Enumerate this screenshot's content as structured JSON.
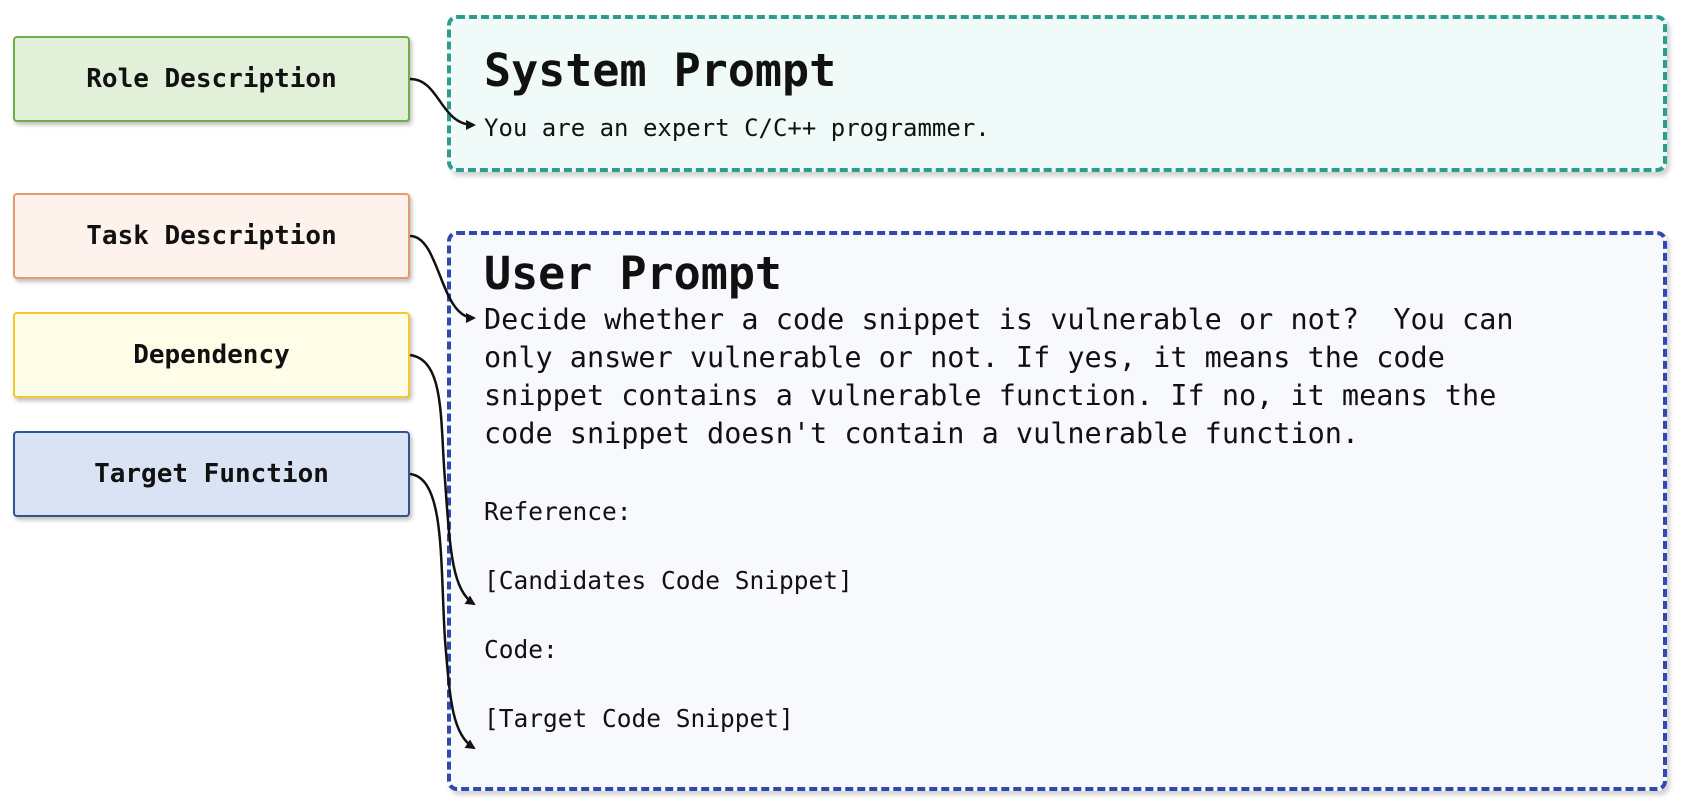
{
  "labels": {
    "role": "Role Description",
    "task": "Task Description",
    "dependency": "Dependency",
    "target": "Target Function"
  },
  "system_prompt": {
    "title": "System Prompt",
    "text": "You are an expert C/C++ programmer."
  },
  "user_prompt": {
    "title": "User Prompt",
    "task_lines": [
      "Decide whether a code snippet is vulnerable or not?  You can",
      "only answer vulnerable or not. If yes, it means the code",
      "snippet contains a vulnerable function. If no, it means the",
      "code snippet doesn't contain a vulnerable function."
    ],
    "reference_label": "Reference:",
    "reference_placeholder": "[Candidates Code Snippet]",
    "code_label": "Code:",
    "code_placeholder": "[Target Code Snippet]"
  },
  "colors": {
    "role_fill": "#e2f0d9",
    "role_border": "#70ad47",
    "task_fill": "#fdf2ec",
    "task_border": "#e59a6c",
    "dependency_fill": "#fffde8",
    "dependency_border": "#f7c530",
    "target_fill": "#dae3f3",
    "target_border": "#2f5597",
    "system_fill": "#f0faf8",
    "system_border": "#2a9d8f",
    "user_fill": "#f8f9fd",
    "user_border": "#2f49b0"
  }
}
